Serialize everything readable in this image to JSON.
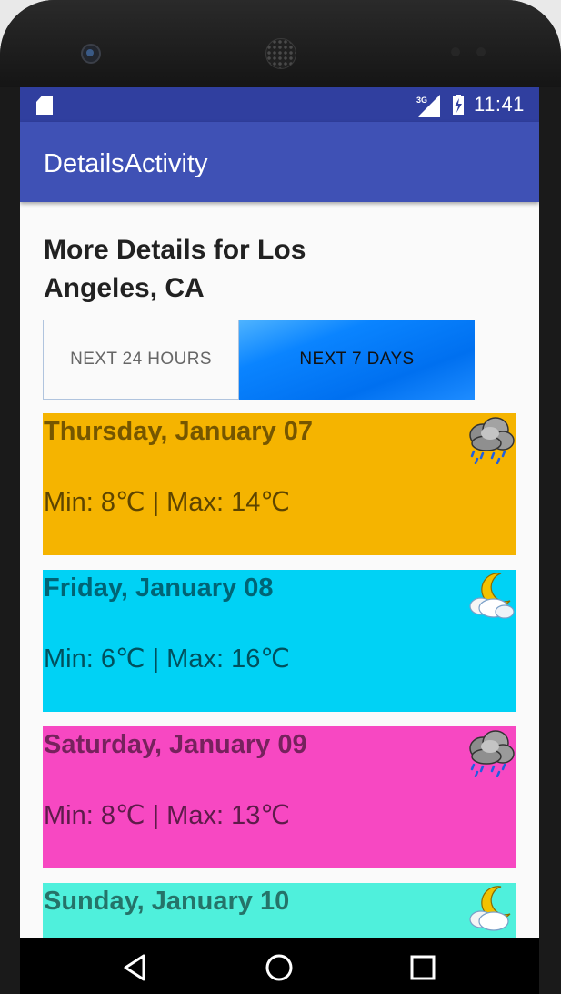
{
  "status_bar": {
    "network": "3G",
    "time": "11:41"
  },
  "app_bar": {
    "title": "DetailsActivity"
  },
  "heading": "More Details for Los Angeles, CA",
  "tabs": {
    "next_24_hours": "NEXT 24 HOURS",
    "next_7_days": "NEXT 7 DAYS",
    "selected": "next_7_days"
  },
  "forecast": [
    {
      "day": "Thursday, January 07",
      "temps": "Min: 8℃ | Max: 14℃",
      "icon": "rain-cloud-icon",
      "color": "#f5b400"
    },
    {
      "day": "Friday, January 08",
      "temps": "Min: 6℃ | Max: 16℃",
      "icon": "moon-cloud-icon",
      "color": "#00d2f5"
    },
    {
      "day": "Saturday, January 09",
      "temps": "Min: 8℃ | Max: 13℃",
      "icon": "rain-cloud-icon",
      "color": "#f748c2"
    },
    {
      "day": "Sunday, January 10",
      "temps": "",
      "icon": "moon-cloud-icon",
      "color": "#4ff0dc"
    }
  ],
  "nav_bar": {
    "buttons": [
      "back-icon",
      "home-icon",
      "recents-icon"
    ]
  }
}
